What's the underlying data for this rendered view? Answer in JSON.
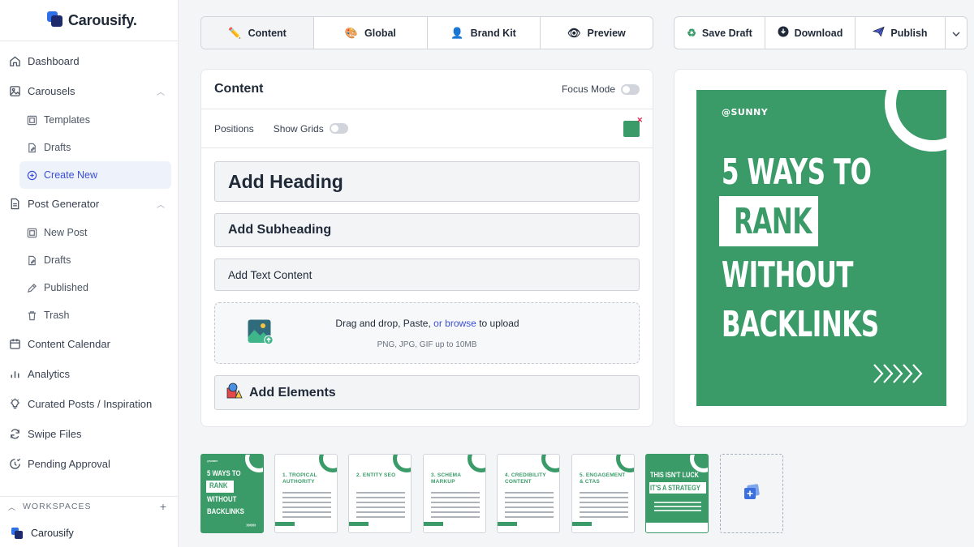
{
  "brand": {
    "name": "Carousify."
  },
  "sidebar": {
    "items": [
      {
        "label": "Dashboard"
      },
      {
        "label": "Carousels"
      },
      {
        "label": "Templates"
      },
      {
        "label": "Drafts"
      },
      {
        "label": "Create New"
      },
      {
        "label": "Post Generator"
      },
      {
        "label": "New Post"
      },
      {
        "label": "Drafts"
      },
      {
        "label": "Published"
      },
      {
        "label": "Trash"
      },
      {
        "label": "Content Calendar"
      },
      {
        "label": "Analytics"
      },
      {
        "label": "Curated Posts / Inspiration"
      },
      {
        "label": "Swipe Files"
      },
      {
        "label": "Pending Approval"
      }
    ],
    "workspaces_label": "WORKSPACES",
    "workspace_name": "Carousify"
  },
  "tabs": [
    {
      "label": "Content"
    },
    {
      "label": "Global"
    },
    {
      "label": "Brand Kit"
    },
    {
      "label": "Preview"
    }
  ],
  "actions": {
    "save": "Save Draft",
    "download": "Download",
    "publish": "Publish"
  },
  "editor": {
    "title": "Content",
    "focus_mode": "Focus Mode",
    "positions": "Positions",
    "show_grids": "Show Grids",
    "heading_placeholder": "Add Heading",
    "subheading_placeholder": "Add Subheading",
    "text_placeholder": "Add Text Content",
    "upload": {
      "prefix": "Drag and drop, Paste,",
      "link": "or browse",
      "suffix": "to upload",
      "formats": "PNG, JPG, GIF up to 10MB"
    },
    "elements": "Add Elements",
    "colors": {
      "accent": "#3a9b68"
    }
  },
  "preview": {
    "handle": "@SUNNY",
    "line1": "5 WAYS TO",
    "line2": "RANK",
    "line3": "WITHOUT",
    "line4": "BACKLINKS",
    "arrows": "»»»»»"
  },
  "thumbnails": [
    {
      "lines": [
        "5 WAYS TO",
        "RANK",
        "WITHOUT",
        "BACKLINKS"
      ]
    },
    {
      "title": "1. TROPICAL AUTHORITY"
    },
    {
      "title": "2. ENTITY SEO"
    },
    {
      "title": "3. SCHEMA MARKUP"
    },
    {
      "title": "4. CREDIBILITY CONTENT"
    },
    {
      "title": "5. ENGAGEMENT & CTAS"
    },
    {
      "lines": [
        "THIS ISN'T LUCK",
        "IT'S A STRATEGY"
      ]
    }
  ]
}
